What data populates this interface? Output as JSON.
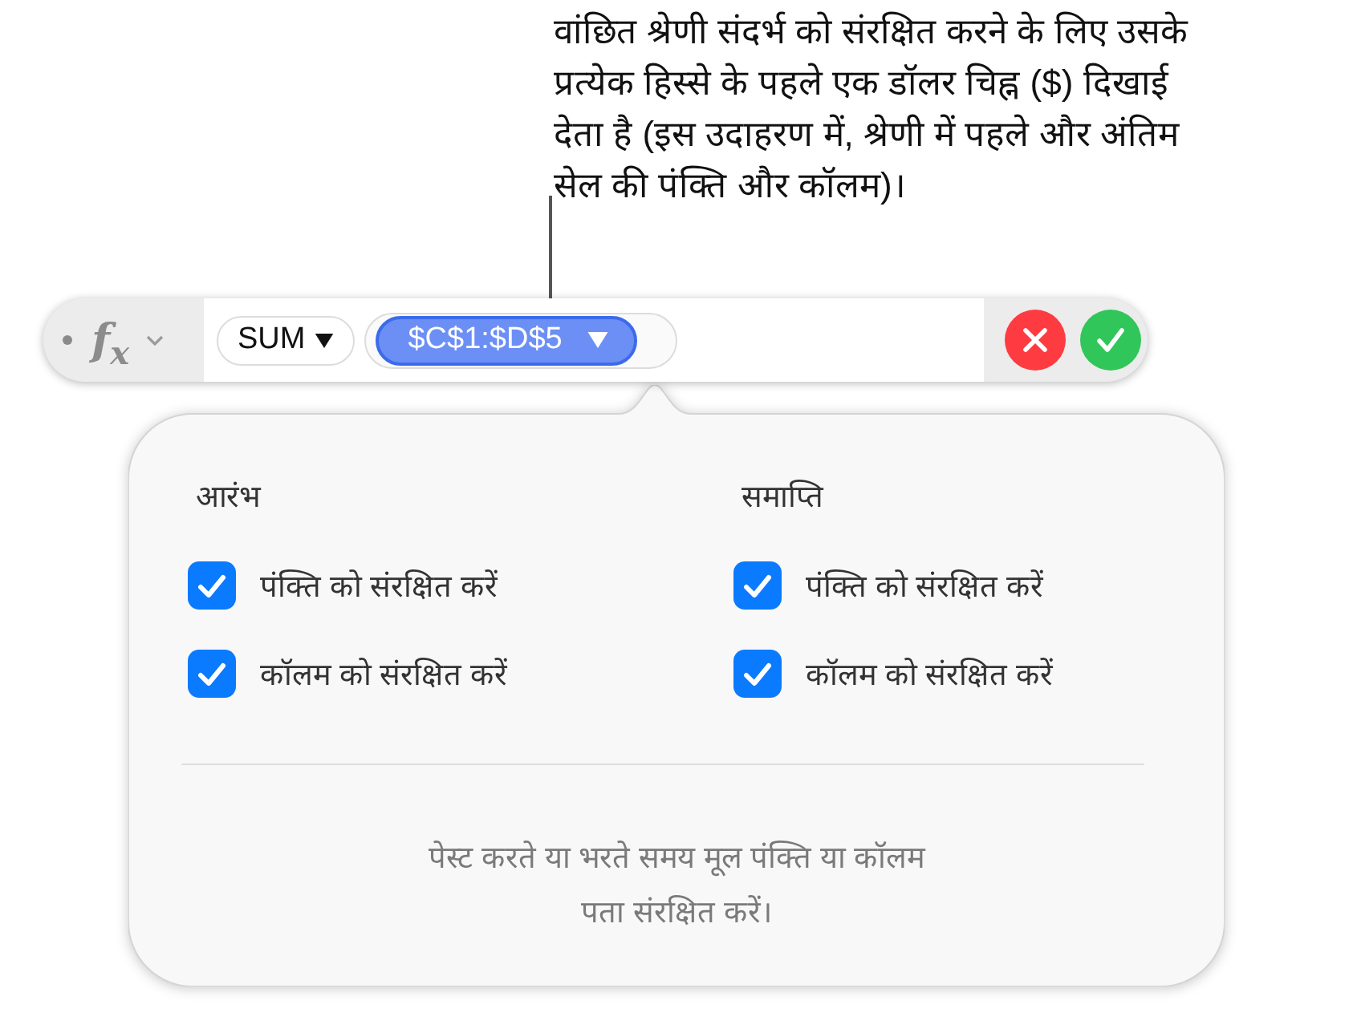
{
  "callout": {
    "lines": [
      "वांछित श्रेणी संदर्भ को संरक्षित करने के लिए उसके",
      "प्रत्येक हिस्से के पहले एक डॉलर चिह्न ($) दिखाई",
      "देता है (इस उदाहरण में, श्रेणी में पहले और अंतिम",
      "सेल की पंक्ति और कॉलम)।"
    ]
  },
  "formula_bar": {
    "function_symbol": "f$_{x}$",
    "tokens": [
      {
        "label": "SUM",
        "selected": false,
        "arguments": [
          {
            "label": "$C$1:$D$5",
            "selected": true
          }
        ]
      }
    ]
  },
  "popover": {
    "columns": [
      {
        "heading": "आरंभ",
        "options": [
          {
            "label": "पंक्ति को संरक्षित करें",
            "checked": true
          },
          {
            "label": "कॉलम को संरक्षित करें",
            "checked": true
          }
        ]
      },
      {
        "heading": "समाप्ति",
        "options": [
          {
            "label": "पंक्ति को संरक्षित करें",
            "checked": true
          },
          {
            "label": "कॉलम को संरक्षित करें",
            "checked": true
          }
        ]
      }
    ],
    "note_lines": [
      "पेस्ट करते या भरते समय मूल पंक्ति या कॉलम",
      "पता संरक्षित करें।"
    ]
  }
}
